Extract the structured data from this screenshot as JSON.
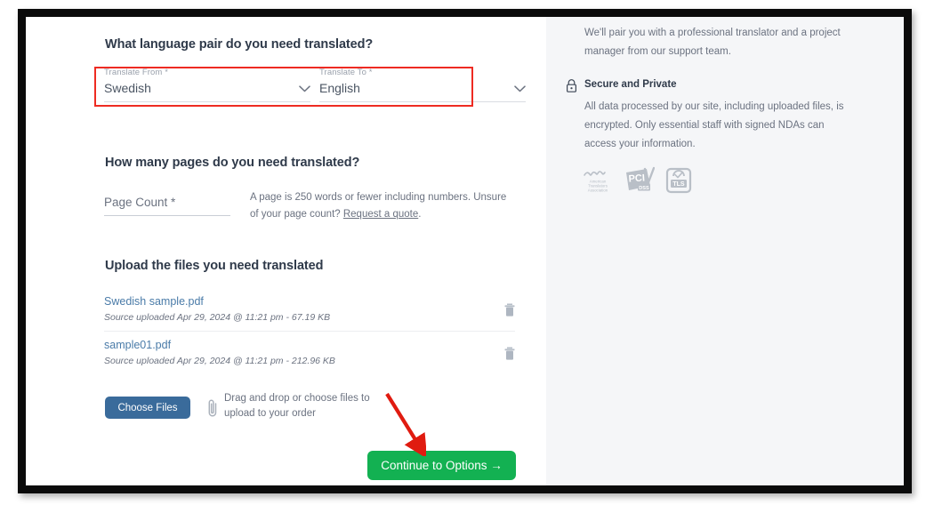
{
  "language_section": {
    "title": "What language pair do you need translated?",
    "from": {
      "label": "Translate From *",
      "value": "Swedish"
    },
    "to": {
      "label": "Translate To *",
      "value": "English"
    }
  },
  "pages_section": {
    "title": "How many pages do you need translated?",
    "page_count_placeholder": "Page Count *",
    "note_part1": "A page is 250 words or fewer including numbers. Unsure of your page count? ",
    "note_link": "Request a quote",
    "note_part2": "."
  },
  "upload_section": {
    "title": "Upload the files you need translated",
    "files": [
      {
        "name": "Swedish sample.pdf",
        "meta": "Source uploaded Apr 29, 2024 @ 11:21 pm - 67.19 KB"
      },
      {
        "name": "sample01.pdf",
        "meta": "Source uploaded Apr 29, 2024 @ 11:21 pm - 212.96 KB"
      }
    ],
    "choose_files_label": "Choose Files",
    "drag_text": "Drag and drop or choose files to upload to your order"
  },
  "footer": {
    "continue_label": "Continue to Options  →"
  },
  "sidebar": {
    "intro": "We'll pair you with a professional translator and a project manager from our support team.",
    "secure_title": "Secure and Private",
    "secure_body": "All data processed by our site, including uploaded files, is encrypted. Only essential staff with signed NDAs can access your information.",
    "badges": [
      {
        "name": "ata-badge",
        "line1": "American",
        "line2": "Translators",
        "line3": "Association",
        "mark": "ata"
      },
      {
        "name": "pci-dss-badge",
        "mark": "PCI",
        "sub": "DSS"
      },
      {
        "name": "tls-badge",
        "mark": "TLS"
      }
    ]
  },
  "colors": {
    "accent_green": "#13b152",
    "accent_blue": "#3a6b9b",
    "link_blue": "#4a7ba8",
    "highlight_red": "#ee2b22",
    "sidebar_bg": "#f5f6f8"
  }
}
